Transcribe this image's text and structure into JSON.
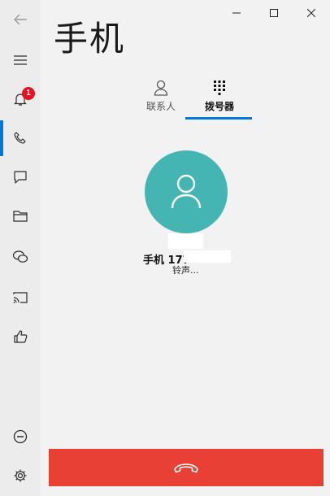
{
  "app": {
    "title": "手机"
  },
  "sidebar": {
    "items": [
      {
        "name": "back",
        "icon": "back-arrow-icon"
      },
      {
        "name": "menu",
        "icon": "hamburger-icon"
      },
      {
        "name": "notifications",
        "icon": "bell-icon",
        "badge": "1"
      },
      {
        "name": "calls",
        "icon": "phone-icon",
        "active": true
      },
      {
        "name": "messages",
        "icon": "chat-icon"
      },
      {
        "name": "photos",
        "icon": "folder-icon"
      },
      {
        "name": "apps",
        "icon": "chat-bubbles-icon"
      },
      {
        "name": "screen",
        "icon": "cast-icon"
      },
      {
        "name": "feedback",
        "icon": "thumbs-up-icon"
      },
      {
        "name": "disconnect",
        "icon": "minus-circle-icon"
      },
      {
        "name": "settings",
        "icon": "gear-icon"
      }
    ]
  },
  "tabs": [
    {
      "label": "联系人",
      "icon": "person-icon"
    },
    {
      "label": "拨号器",
      "icon": "keypad-icon",
      "selected": true
    }
  ],
  "call": {
    "caller_label": "手机",
    "caller_number": "177",
    "status": "铃声..."
  },
  "colors": {
    "accent": "#0078d7",
    "avatar": "#44b5b3",
    "hangup": "#e84034",
    "badge": "#e81123"
  }
}
